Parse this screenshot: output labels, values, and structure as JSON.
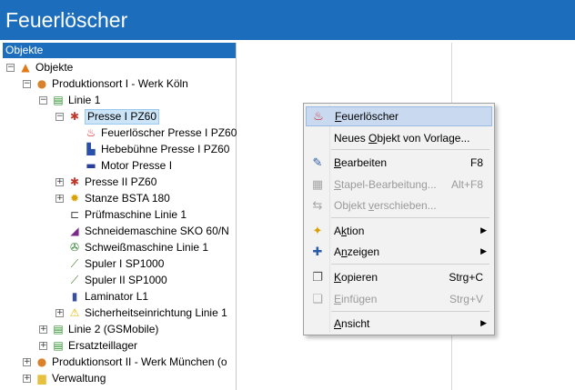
{
  "app": {
    "title": "Feuerlöscher"
  },
  "panel": {
    "header": "Objekte"
  },
  "tree": [
    {
      "label": "Objekte",
      "icon": "objects-root-icon",
      "level": 0,
      "expander": "−"
    },
    {
      "label": "Produktionsort I - Werk Köln",
      "icon": "site-icon",
      "level": 1,
      "expander": "−"
    },
    {
      "label": "Linie 1",
      "icon": "line-icon",
      "level": 2,
      "expander": "−"
    },
    {
      "label": "Presse I PZ60",
      "icon": "press-icon",
      "level": 3,
      "expander": "−",
      "selected": true
    },
    {
      "label": "Feuerlöscher Presse I PZ60",
      "icon": "fire-extinguisher-icon",
      "level": 4,
      "expander": ""
    },
    {
      "label": "Hebebühne Presse I PZ60",
      "icon": "lift-icon",
      "level": 4,
      "expander": ""
    },
    {
      "label": "Motor Presse I",
      "icon": "motor-icon",
      "level": 4,
      "expander": ""
    },
    {
      "label": "Presse II PZ60",
      "icon": "press-icon",
      "level": 3,
      "expander": "+"
    },
    {
      "label": "Stanze BSTA 180",
      "icon": "gear-icon",
      "level": 3,
      "expander": "+"
    },
    {
      "label": "Prüfmaschine Linie 1",
      "icon": "test-machine-icon",
      "level": 3,
      "expander": ""
    },
    {
      "label": "Schneidemaschine SKO 60/N",
      "icon": "cutting-machine-icon",
      "level": 3,
      "expander": ""
    },
    {
      "label": "Schweißmaschine Linie 1",
      "icon": "welding-machine-icon",
      "level": 3,
      "expander": ""
    },
    {
      "label": "Spuler I SP1000",
      "icon": "spooler-icon",
      "level": 3,
      "expander": ""
    },
    {
      "label": "Spuler II SP1000",
      "icon": "spooler-icon",
      "level": 3,
      "expander": ""
    },
    {
      "label": "Laminator L1",
      "icon": "laminator-icon",
      "level": 3,
      "expander": ""
    },
    {
      "label": "Sicherheitseinrichtung Linie 1",
      "icon": "warning-icon",
      "level": 3,
      "expander": "+"
    },
    {
      "label": "Linie 2 (GSMobile)",
      "icon": "line-icon",
      "level": 2,
      "expander": "+"
    },
    {
      "label": "Ersatzteillager",
      "icon": "line-icon",
      "level": 2,
      "expander": "+"
    },
    {
      "label": "Produktionsort II - Werk München (o",
      "icon": "site-icon",
      "level": 1,
      "expander": "+"
    },
    {
      "label": "Verwaltung",
      "icon": "folder-icon",
      "level": 1,
      "expander": "+"
    }
  ],
  "context_menu": {
    "items": [
      {
        "id": "feuerloescher",
        "label": "Feuerlöscher",
        "key": "",
        "icon": "fire-extinguisher-icon",
        "highlighted": true,
        "disabled": false,
        "submenu": false
      },
      {
        "id": "neues-objekt",
        "label": "Neues Objekt von Vorlage...",
        "key": "",
        "icon": "",
        "highlighted": false,
        "disabled": false,
        "submenu": false
      },
      {
        "id": "bearbeiten",
        "label": "Bearbeiten",
        "key": "F8",
        "icon": "edit-icon",
        "highlighted": false,
        "disabled": false,
        "submenu": false
      },
      {
        "id": "stapel",
        "label": "Stapel-Bearbeitung...",
        "key": "Alt+F8",
        "icon": "batch-edit-icon",
        "highlighted": false,
        "disabled": true,
        "submenu": false
      },
      {
        "id": "verschieben",
        "label": "Objekt verschieben...",
        "key": "",
        "icon": "move-icon",
        "highlighted": false,
        "disabled": true,
        "submenu": false
      },
      {
        "id": "aktion",
        "label": "Aktion",
        "key": "",
        "icon": "action-icon",
        "highlighted": false,
        "disabled": false,
        "submenu": true
      },
      {
        "id": "anzeigen",
        "label": "Anzeigen",
        "key": "",
        "icon": "pin-icon",
        "highlighted": false,
        "disabled": false,
        "submenu": true
      },
      {
        "id": "kopieren",
        "label": "Kopieren",
        "key": "Strg+C",
        "icon": "copy-icon",
        "highlighted": false,
        "disabled": false,
        "submenu": false
      },
      {
        "id": "einfuegen",
        "label": "Einfügen",
        "key": "Strg+V",
        "icon": "paste-icon",
        "highlighted": false,
        "disabled": true,
        "submenu": false
      },
      {
        "id": "ansicht",
        "label": "Ansicht",
        "key": "",
        "icon": "",
        "highlighted": false,
        "disabled": false,
        "submenu": true
      }
    ]
  },
  "colors": {
    "accent": "#1c6ebd",
    "selection": "#cce4f7",
    "menu_highlight": "#c8d9f0"
  }
}
